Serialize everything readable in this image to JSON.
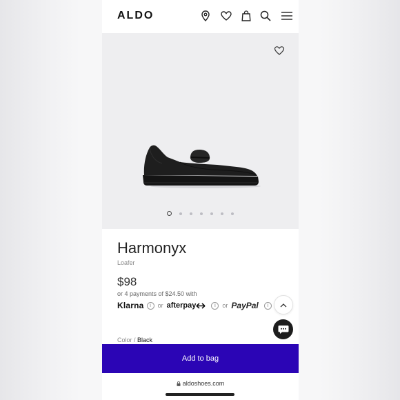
{
  "header": {
    "logo": "ALDO",
    "icons": [
      "location-icon",
      "heart-icon",
      "bag-icon",
      "search-icon",
      "menu-icon"
    ]
  },
  "gallery": {
    "image_count": 7,
    "active_index": 0,
    "favorite_icon": "heart-icon"
  },
  "product": {
    "name": "Harmonyx",
    "category": "Loafer",
    "price": "$98",
    "installments": "or 4 payments of $24.50 with",
    "payment_options": {
      "klarna": "Klarna",
      "or1": "or",
      "afterpay": "afterpay",
      "or2": "or",
      "paypal": "PayPal",
      "info_glyph": "i"
    },
    "color_label": "Color /",
    "color_value": "Black"
  },
  "actions": {
    "add_to_bag": "Add to bag",
    "scroll_up_icon": "chevron-up-icon",
    "chat_icon": "chat-icon"
  },
  "browser": {
    "url": "aldoshoes.com"
  },
  "colors": {
    "cta": "#2b05b5",
    "gallery_bg": "#eeeef0"
  }
}
